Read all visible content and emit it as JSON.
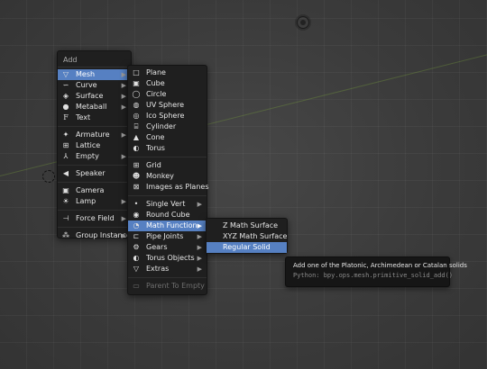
{
  "add_menu": {
    "title": "Add",
    "items": [
      {
        "label": "Mesh",
        "icon": "mesh-icon",
        "submenu": true,
        "active": true
      },
      {
        "label": "Curve",
        "icon": "curve-icon",
        "submenu": true
      },
      {
        "label": "Surface",
        "icon": "surface-icon",
        "submenu": true
      },
      {
        "label": "Metaball",
        "icon": "metaball-icon",
        "submenu": true
      },
      {
        "label": "Text",
        "icon": "text-icon",
        "submenu": false
      },
      {
        "label": "Armature",
        "icon": "armature-icon",
        "submenu": true
      },
      {
        "label": "Lattice",
        "icon": "lattice-icon",
        "submenu": false
      },
      {
        "label": "Empty",
        "icon": "empty-icon",
        "submenu": true
      },
      {
        "label": "Speaker",
        "icon": "speaker-icon",
        "submenu": false
      },
      {
        "label": "Camera",
        "icon": "camera-icon",
        "submenu": false
      },
      {
        "label": "Lamp",
        "icon": "lamp-icon",
        "submenu": true
      },
      {
        "label": "Force Field",
        "icon": "force-field-icon",
        "submenu": true
      },
      {
        "label": "Group Instance",
        "icon": "group-instance-icon",
        "submenu": true
      }
    ]
  },
  "mesh_menu": {
    "items": [
      {
        "label": "Plane",
        "icon": "plane-icon"
      },
      {
        "label": "Cube",
        "icon": "cube-icon"
      },
      {
        "label": "Circle",
        "icon": "circle-icon"
      },
      {
        "label": "UV Sphere",
        "icon": "uv-sphere-icon"
      },
      {
        "label": "Ico Sphere",
        "icon": "ico-sphere-icon"
      },
      {
        "label": "Cylinder",
        "icon": "cylinder-icon"
      },
      {
        "label": "Cone",
        "icon": "cone-icon"
      },
      {
        "label": "Torus",
        "icon": "torus-icon"
      },
      {
        "label": "Grid",
        "icon": "grid-icon"
      },
      {
        "label": "Monkey",
        "icon": "monkey-icon"
      },
      {
        "label": "Images as Planes",
        "icon": "images-as-planes-icon"
      },
      {
        "label": "Single Vert",
        "icon": "single-vert-icon",
        "submenu": true
      },
      {
        "label": "Round Cube",
        "icon": "round-cube-icon"
      },
      {
        "label": "Math Function",
        "icon": "math-function-icon",
        "submenu": true,
        "active": true
      },
      {
        "label": "Pipe Joints",
        "icon": "pipe-joints-icon",
        "submenu": true
      },
      {
        "label": "Gears",
        "icon": "gears-icon",
        "submenu": true
      },
      {
        "label": "Torus Objects",
        "icon": "torus-objects-icon",
        "submenu": true
      },
      {
        "label": "Extras",
        "icon": "extras-icon",
        "submenu": true
      },
      {
        "label": "Parent To Empty",
        "icon": "parent-to-empty-icon",
        "disabled": true
      }
    ]
  },
  "math_menu": {
    "items": [
      {
        "label": "Z Math Surface"
      },
      {
        "label": "XYZ Math Surface"
      },
      {
        "label": "Regular Solid",
        "active": true
      }
    ]
  },
  "tooltip": {
    "text": "Add one of the Platonic, Archimedean or Catalan solids",
    "python": "Python: bpy.ops.mesh.primitive_solid_add()"
  },
  "colors": {
    "highlight": "#5680c2",
    "menu_bg": "#1f1f1f",
    "viewport_bg": "#393939"
  }
}
